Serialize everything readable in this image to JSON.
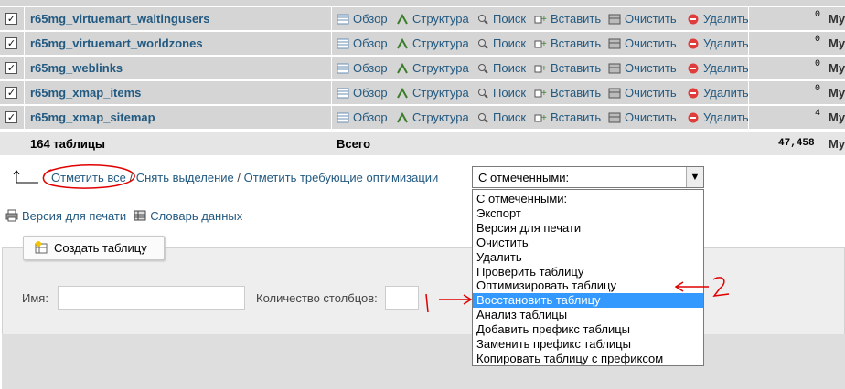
{
  "table_rows": [
    {
      "name": "r65mg_virtuemart_waitingusers",
      "rows": "0",
      "engine": "My"
    },
    {
      "name": "r65mg_virtuemart_worldzones",
      "rows": "0",
      "engine": "My"
    },
    {
      "name": "r65mg_weblinks",
      "rows": "0",
      "engine": "My"
    },
    {
      "name": "r65mg_xmap_items",
      "rows": "0",
      "engine": "My"
    },
    {
      "name": "r65mg_xmap_sitemap",
      "rows": "4",
      "engine": "My"
    }
  ],
  "actions": {
    "browse": "Обзор",
    "structure": "Структура",
    "search": "Поиск",
    "insert": "Вставить",
    "empty": "Очистить",
    "drop": "Удалить"
  },
  "summary": {
    "tables_count": "164 таблицы",
    "sum_label": "Всего",
    "total_rows": "47,458",
    "engine": "My"
  },
  "selection": {
    "check_all": "Отметить все",
    "separator1": " / ",
    "uncheck_all": "Снять выделение",
    "separator2": " / ",
    "check_overhead": "Отметить требующие оптимизации"
  },
  "with_selected": {
    "current": "С отмеченными:",
    "options": [
      "С отмеченными:",
      "Экспорт",
      "Версия для печати",
      "Очистить",
      "Удалить",
      "Проверить таблицу",
      "Оптимизировать таблицу",
      "Восстановить таблицу",
      "Анализ таблицы",
      "Добавить префикс таблицы",
      "Заменить префикс таблицы",
      "Копировать таблицу с префиксом"
    ],
    "highlighted": "Восстановить таблицу"
  },
  "links": {
    "print_view": "Версия для печати",
    "data_dictionary": "Словарь данных"
  },
  "create_table": {
    "button_label": "Создать таблицу",
    "name_label": "Имя:",
    "name_value": "",
    "columns_label": "Количество столбцов:",
    "columns_value": ""
  },
  "annotations": {
    "arrow1_label": "1",
    "arrow2_label": "2",
    "color": "#e00000"
  },
  "colors": {
    "link": "#235a81",
    "row_bg": "#d5d5d5",
    "highlight": "#3399ff"
  }
}
